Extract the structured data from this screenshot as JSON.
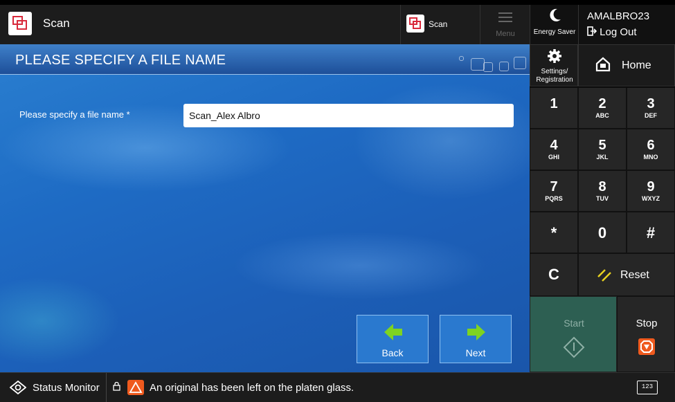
{
  "topbar": {
    "app_title": "Scan",
    "scan_tab_label": "Scan",
    "menu_label": "Menu",
    "energy_saver_label": "Energy Saver",
    "user_name": "AMALBRO23",
    "logout_label": "Log Out",
    "icons": [
      "scan-app-icon",
      "menu-icon",
      "moon-icon",
      "logout-icon"
    ]
  },
  "main": {
    "title": "PLEASE SPECIFY A FILE NAME",
    "field_label": "Please specify a file name *",
    "field_value": "Scan_Alex Albro",
    "back_label": "Back",
    "next_label": "Next",
    "accent_color": "#7ed321"
  },
  "rpanel": {
    "settings_label_1": "Settings/",
    "settings_label_2": "Registration",
    "home_label": "Home",
    "keys": [
      {
        "main": "1",
        "sub": ""
      },
      {
        "main": "2",
        "sub": "ABC"
      },
      {
        "main": "3",
        "sub": "DEF"
      },
      {
        "main": "4",
        "sub": "GHI"
      },
      {
        "main": "5",
        "sub": "JKL"
      },
      {
        "main": "6",
        "sub": "MNO"
      },
      {
        "main": "7",
        "sub": "PQRS"
      },
      {
        "main": "8",
        "sub": "TUV"
      },
      {
        "main": "9",
        "sub": "WXYZ"
      },
      {
        "main": "*",
        "sub": ""
      },
      {
        "main": "0",
        "sub": ""
      },
      {
        "main": "#",
        "sub": ""
      }
    ],
    "clear_label": "C",
    "reset_label": "Reset",
    "start_label": "Start",
    "stop_label": "Stop",
    "stop_color": "#ef5a1e",
    "start_color": "#2d5f52"
  },
  "bottombar": {
    "status_label": "Status Monitor",
    "message": "An original has been left on the platen glass.",
    "keyboard_label": "123"
  }
}
